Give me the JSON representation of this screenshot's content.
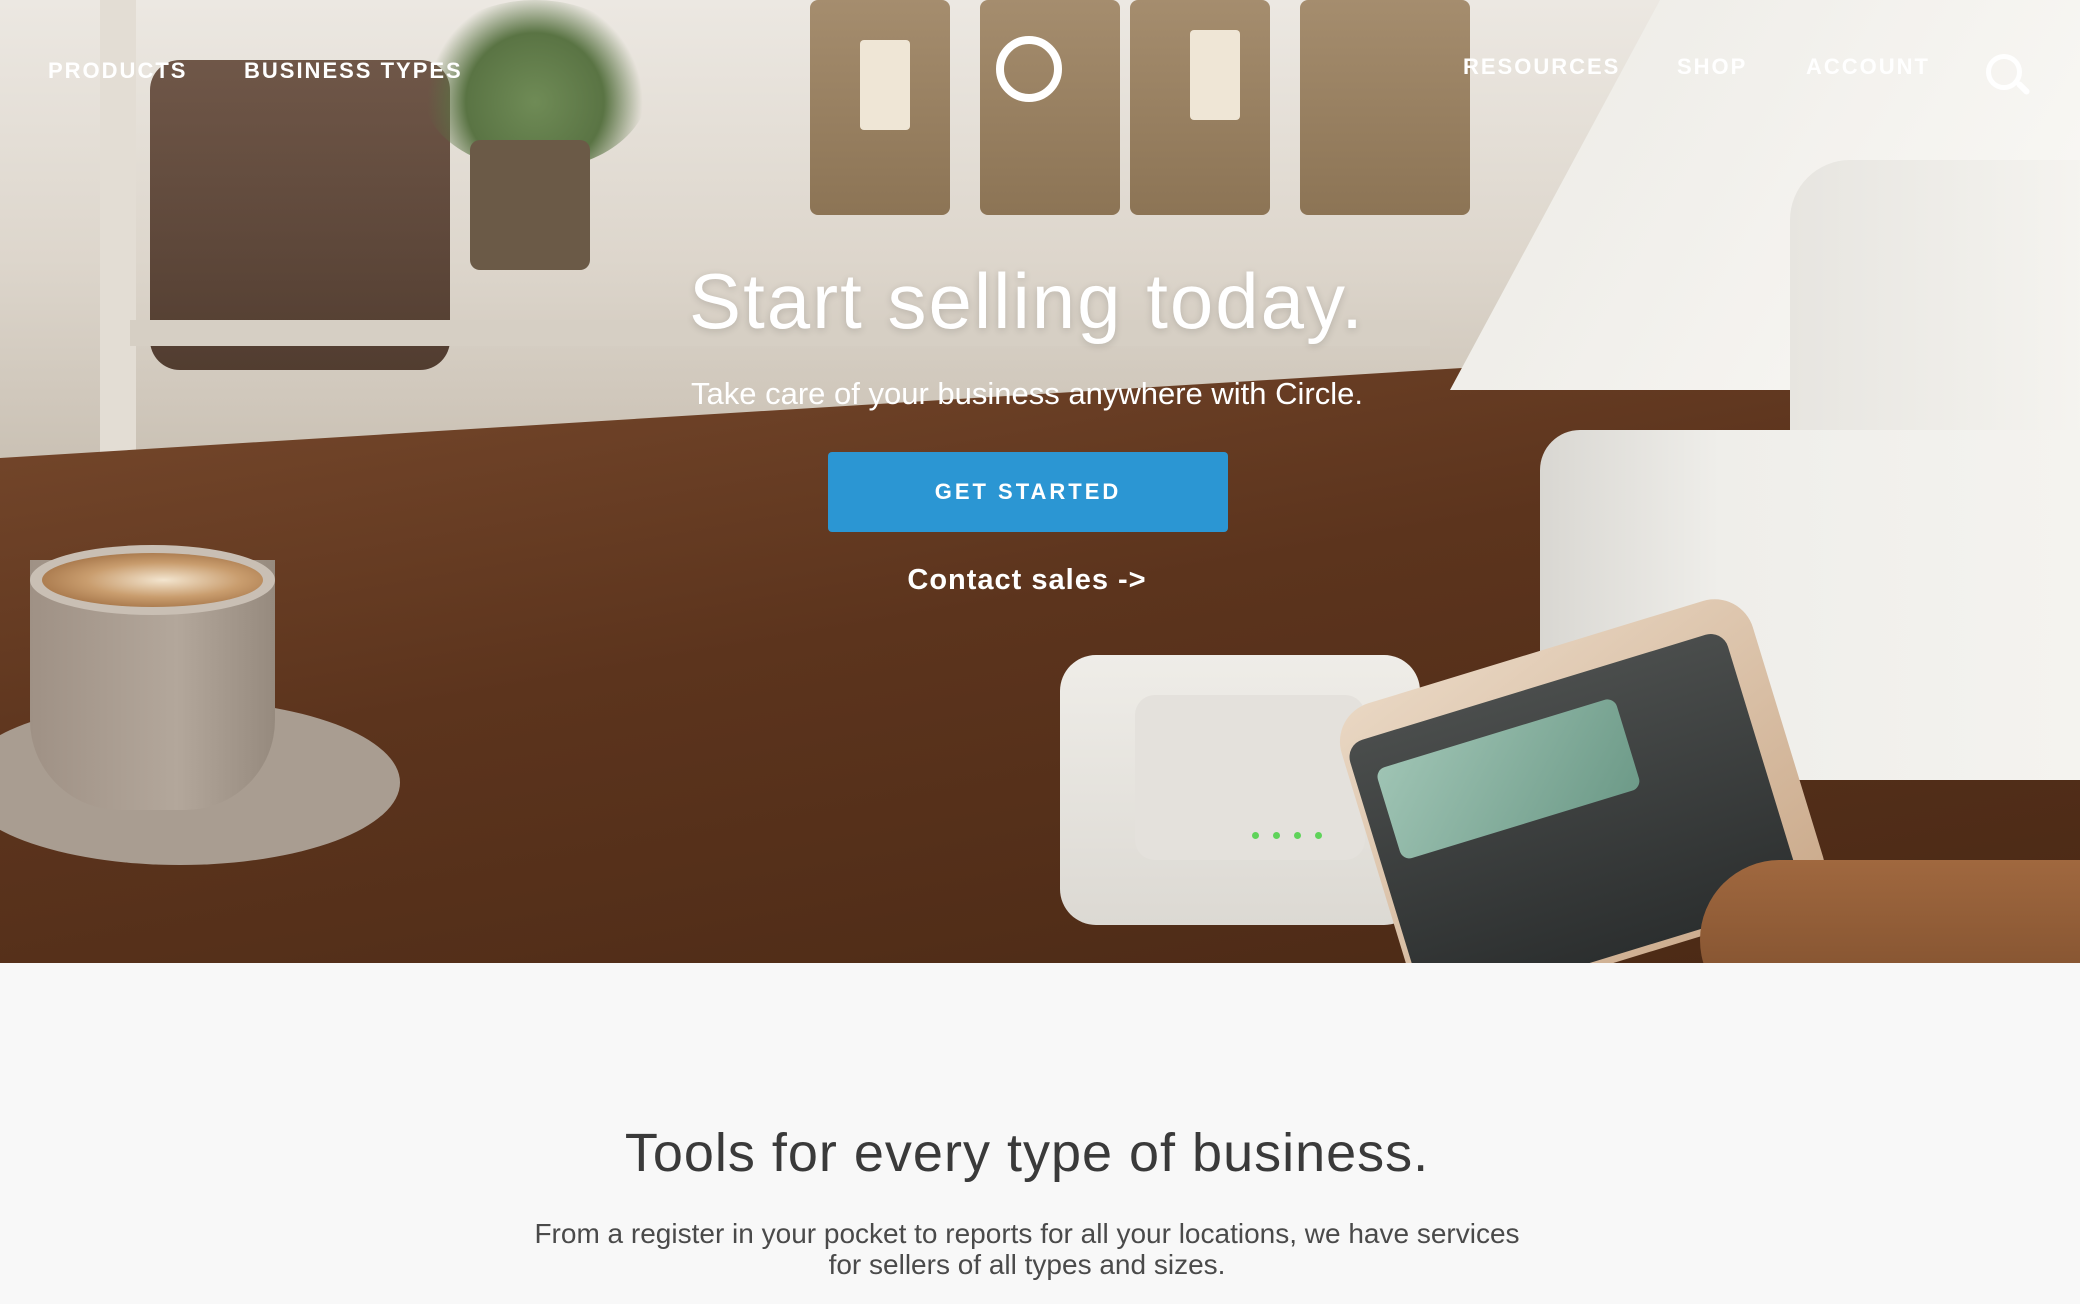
{
  "nav": {
    "products": "PRODUCTS",
    "business_types": "BUSINESS TYPES",
    "resources": "RESOURCES",
    "shop": "SHOP",
    "account": "ACCOUNT",
    "logo_icon": "circle-logo-icon",
    "search_icon": "search-icon"
  },
  "hero": {
    "title": "Start selling today.",
    "subtitle": "Take care of your business anywhere with Circle.",
    "cta_label": "GET STARTED",
    "contact_label": "Contact sales ->"
  },
  "tools": {
    "title": "Tools for every type of business.",
    "description": "From a register in your pocket to reports for all your locations, we have services for sellers of all types and sizes."
  },
  "colors": {
    "cta": "#2b96d3",
    "section_bg": "#f8f8f8",
    "text_dark": "#3a3a3a"
  }
}
